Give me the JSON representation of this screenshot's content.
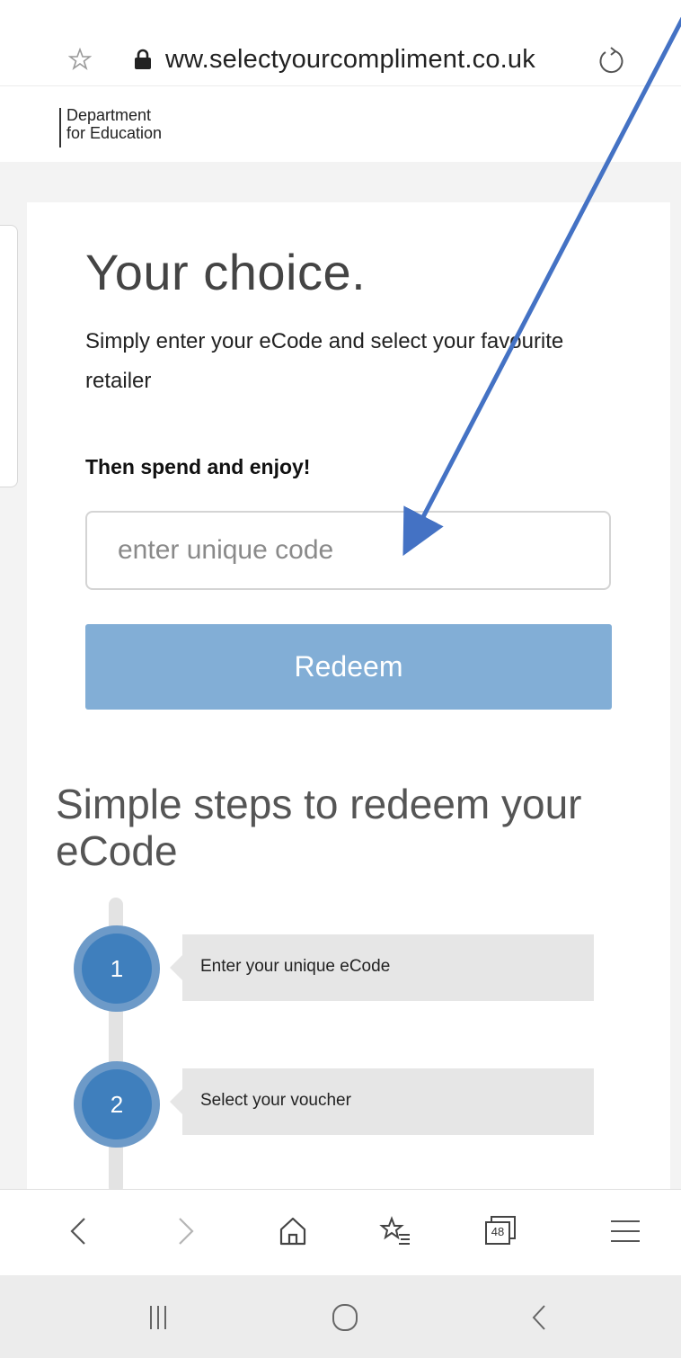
{
  "browser": {
    "url": "ww.selectyourcompliment.co.uk",
    "icons": [
      "star-outline-icon",
      "lock-icon",
      "reload-icon"
    ]
  },
  "site": {
    "logo_line1": "Department",
    "logo_line2": "for Education"
  },
  "hero": {
    "title": "Your choice.",
    "description": "Simply enter your eCode and select your favourite retailer",
    "subheading": "Then spend and enjoy!",
    "code_placeholder": "enter unique code",
    "redeem_label": "Redeem"
  },
  "steps": {
    "title": "Simple steps to redeem your eCode",
    "items": [
      {
        "number": "1",
        "label": "Enter your unique eCode"
      },
      {
        "number": "2",
        "label": "Select your voucher"
      }
    ]
  },
  "toolbar": {
    "tabs_count": "48",
    "icons": [
      "back-icon",
      "forward-icon",
      "home-icon",
      "bookmarks-icon",
      "tabs-icon",
      "menu-icon"
    ]
  },
  "android_nav": {
    "icons": [
      "recents-icon",
      "home-circle-icon",
      "back-chevron-icon"
    ]
  },
  "colors": {
    "redeem_button": "#82aed6",
    "step_circle_outer": "#6d9ac8",
    "step_circle_inner": "#3f7fbd",
    "annotation_arrow": "#4472c4"
  }
}
